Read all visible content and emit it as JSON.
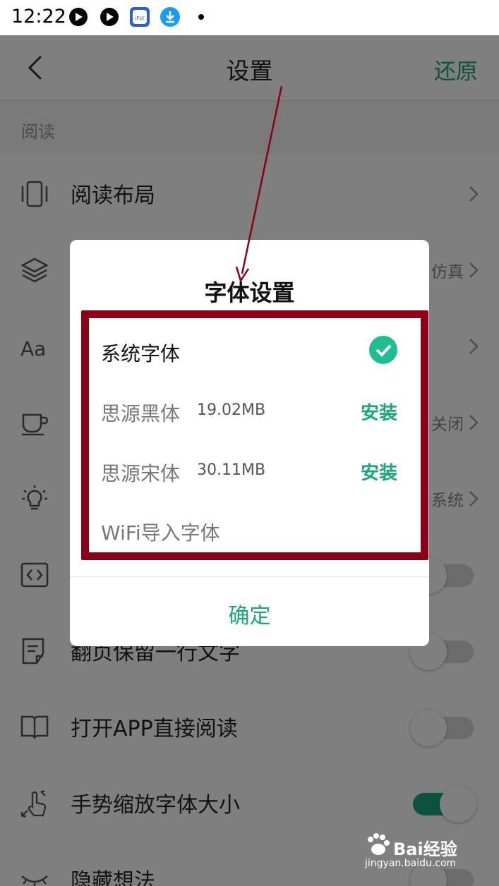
{
  "status": {
    "time": "12:22"
  },
  "nav": {
    "title": "设置",
    "restore": "还原"
  },
  "section": {
    "label": "阅读"
  },
  "rows": [
    {
      "label": "阅读布局",
      "value": ""
    },
    {
      "label": "",
      "value": "仿真"
    },
    {
      "label": "",
      "value": ""
    },
    {
      "label": "",
      "value": "关闭"
    },
    {
      "label": "",
      "value": "系统"
    },
    {
      "label": "",
      "value": ""
    },
    {
      "label": "翻页保留一行文字",
      "value": ""
    },
    {
      "label": "打开APP直接阅读",
      "value": ""
    },
    {
      "label": "手势缩放字体大小",
      "value": ""
    },
    {
      "label": "隐藏想法",
      "value": ""
    }
  ],
  "toggles": {
    "row6": false,
    "row7": false,
    "row8": false,
    "row9": true
  },
  "dialog": {
    "title": "字体设置",
    "options": [
      {
        "name": "系统字体",
        "size": "",
        "action": ""
      },
      {
        "name": "思源黑体",
        "size": "19.02MB",
        "action": "安装"
      },
      {
        "name": "思源宋体",
        "size": "30.11MB",
        "action": "安装"
      },
      {
        "name": "WiFi导入字体",
        "size": "",
        "action": ""
      }
    ],
    "confirm": "确定"
  },
  "watermark": {
    "brand": "Bai经验",
    "url": "jingyan.baidu.com"
  },
  "colors": {
    "accent": "#1aa57a",
    "highlight_box": "#8b0016"
  }
}
